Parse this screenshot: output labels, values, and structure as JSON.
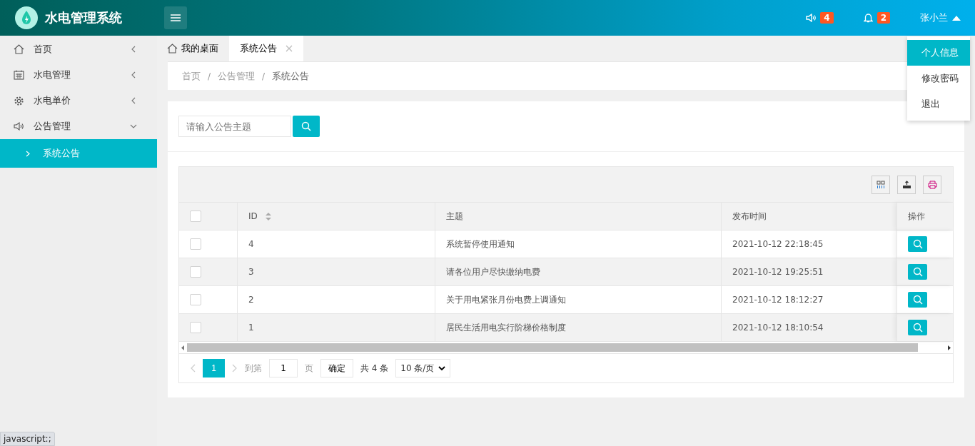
{
  "header": {
    "logo_title": "水电管理系统",
    "speaker_count": "4",
    "bell_count": "2",
    "user_name": "张小兰",
    "user_menu_open": true
  },
  "user_menu": [
    {
      "label": "个人信息",
      "selected": true
    },
    {
      "label": "修改密码",
      "selected": false
    },
    {
      "label": "退出",
      "selected": false
    }
  ],
  "sidebar": {
    "items": [
      {
        "label": "首页",
        "kind": "home",
        "expanded": false
      },
      {
        "label": "水电管理",
        "kind": "calendar",
        "expanded": false
      },
      {
        "label": "水电单价",
        "kind": "gear",
        "expanded": false
      },
      {
        "label": "公告管理",
        "kind": "speaker",
        "expanded": true,
        "children": [
          {
            "label": "系统公告",
            "selected": true
          }
        ]
      }
    ]
  },
  "tabs": [
    {
      "label": "我的桌面",
      "kind": "home",
      "selected": false
    },
    {
      "label": "系统公告",
      "kind": "closable",
      "selected": true
    }
  ],
  "breadcrumb": [
    "首页",
    "/",
    "公告管理",
    "/",
    "系统公告"
  ],
  "search": {
    "placeholder": "请输入公告主题"
  },
  "table": {
    "columns": [
      "ID",
      "主题",
      "发布时间",
      "操作"
    ],
    "select_all_checked": false,
    "rows": [
      {
        "checked": false,
        "id": "4",
        "subject": "系统暂停使用通知",
        "time": "2021-10-12 22:18:45"
      },
      {
        "checked": false,
        "id": "3",
        "subject": "请各位用户尽快缴纳电费",
        "time": "2021-10-12 19:25:51"
      },
      {
        "checked": false,
        "id": "2",
        "subject": "关于用电紧张月份电费上调通知",
        "time": "2021-10-12 18:12:27"
      },
      {
        "checked": false,
        "id": "1",
        "subject": "居民生活用电实行阶梯价格制度",
        "time": "2021-10-12 18:10:54"
      }
    ]
  },
  "pagination": {
    "pages": [
      {
        "label": "1",
        "selected": true
      }
    ],
    "goto_label": "到第",
    "goto_value": "1",
    "page_unit": "页",
    "confirm": "确定",
    "total": "共 4 条",
    "page_size": "10 条/页"
  },
  "status_url": "javascript:;"
}
